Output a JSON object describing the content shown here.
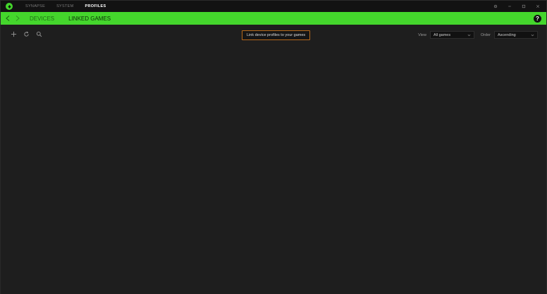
{
  "titlebar": {
    "tabs": [
      "SYNAPSE",
      "SYSTEM",
      "PROFILES"
    ],
    "active_tab": "PROFILES"
  },
  "nav": {
    "sub_tabs": [
      "DEVICES",
      "LINKED GAMES"
    ],
    "active_sub_tab": "LINKED GAMES",
    "help_label": "?"
  },
  "toolbar": {
    "icons": [
      "add-icon",
      "refresh-icon",
      "search-icon"
    ],
    "hint": "Link device profiles to your games"
  },
  "filters": {
    "view_label": "View",
    "view_value": "All games",
    "order_label": "Order",
    "order_value": "Ascending"
  },
  "colors": {
    "accent": "#44d62c",
    "background": "#1e1e1e",
    "titlebar": "#121212",
    "hint_border": "#b86a1a"
  }
}
